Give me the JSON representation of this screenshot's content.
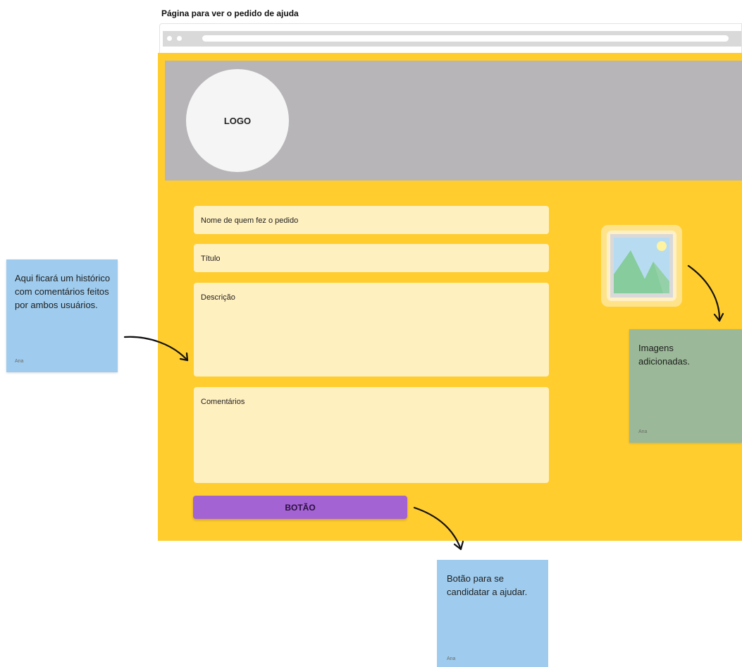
{
  "frame": {
    "title": "Página para ver o pedido de ajuda"
  },
  "page": {
    "logo_label": "LOGO",
    "fields": [
      {
        "label": "Nome de quem fez o pedido"
      },
      {
        "label": "Título"
      },
      {
        "label": "Descrição"
      },
      {
        "label": "Comentários"
      }
    ],
    "button_label": "BOTÃO"
  },
  "stickies": {
    "history": {
      "text": "Aqui ficará um histórico com comentários feitos por ambos usuários.",
      "author": "Ana"
    },
    "images": {
      "text": "Imagens adicionadas.",
      "author": "Ana"
    },
    "button": {
      "text": "Botão para se candidatar a ajudar.",
      "author": "Ana"
    }
  },
  "colors": {
    "page_background": "#ffcd2e",
    "header": "#b7b5b8",
    "field": "#fff0c0",
    "button": "#a463d3",
    "sticky_blue": "#9fccee",
    "sticky_green": "#9bb998"
  },
  "icons": {
    "image_placeholder": "image-icon",
    "arrow": "arrow-icon"
  }
}
